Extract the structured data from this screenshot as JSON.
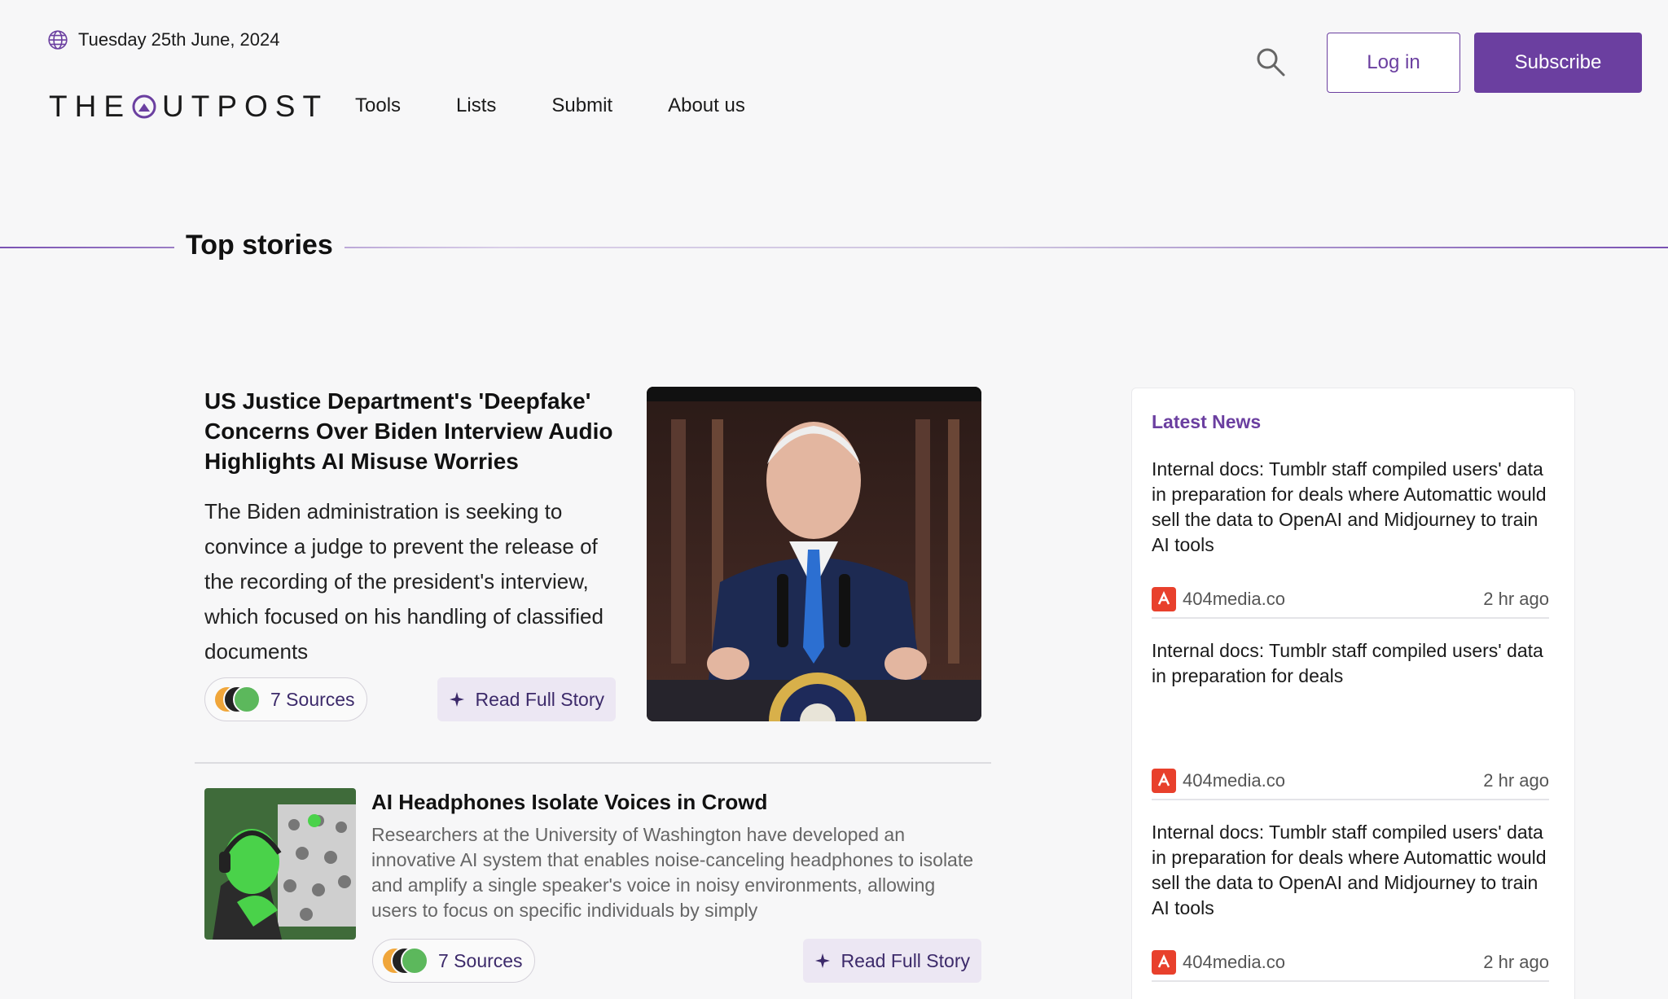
{
  "header": {
    "date": "Tuesday 25th June, 2024",
    "logo_text_left": "THE",
    "logo_text_right": "UTPOST",
    "nav": [
      "Tools",
      "Lists",
      "Submit",
      "About us"
    ],
    "login_label": "Log in",
    "subscribe_label": "Subscribe"
  },
  "section_title": "Top stories",
  "stories": [
    {
      "headline": "US Justice Department's 'Deepfake' Concerns Over Biden Interview Audio Highlights AI Misuse Worries",
      "summary": "The Biden administration is seeking to convince a judge to prevent the release of the recording of the president's interview, which focused on his handling of classified documents",
      "sources_label": "7 Sources",
      "read_label": "Read Full Story"
    },
    {
      "headline": "AI Headphones Isolate Voices in Crowd",
      "summary": "Researchers at the University of Washington have developed an innovative AI system that enables noise-canceling headphones to isolate and amplify a single speaker's voice in noisy environments, allowing users to focus on specific individuals by simply",
      "sources_label": "7 Sources",
      "read_label": "Read Full Story"
    }
  ],
  "sidebar": {
    "title": "Latest News",
    "items": [
      {
        "title": "Internal docs: Tumblr staff compiled users' data in preparation for deals where Automattic would sell the data to OpenAI and Midjourney to train AI tools",
        "source": "404media.co",
        "time": "2 hr ago"
      },
      {
        "title": "Internal docs: Tumblr staff compiled users' data in preparation for deals",
        "source": "404media.co",
        "time": "2 hr ago"
      },
      {
        "title": "Internal docs: Tumblr staff compiled users' data in preparation for deals where Automattic would sell the data to OpenAI and Midjourney to train AI tools",
        "source": "404media.co",
        "time": "2 hr ago"
      }
    ]
  },
  "colors": {
    "brand": "#6b3fa0",
    "background": "#f7f7f8",
    "source_badge": "#e8402c"
  },
  "icons": [
    "globe-icon",
    "search-icon",
    "sparkle-icon",
    "source-logo-icon"
  ]
}
